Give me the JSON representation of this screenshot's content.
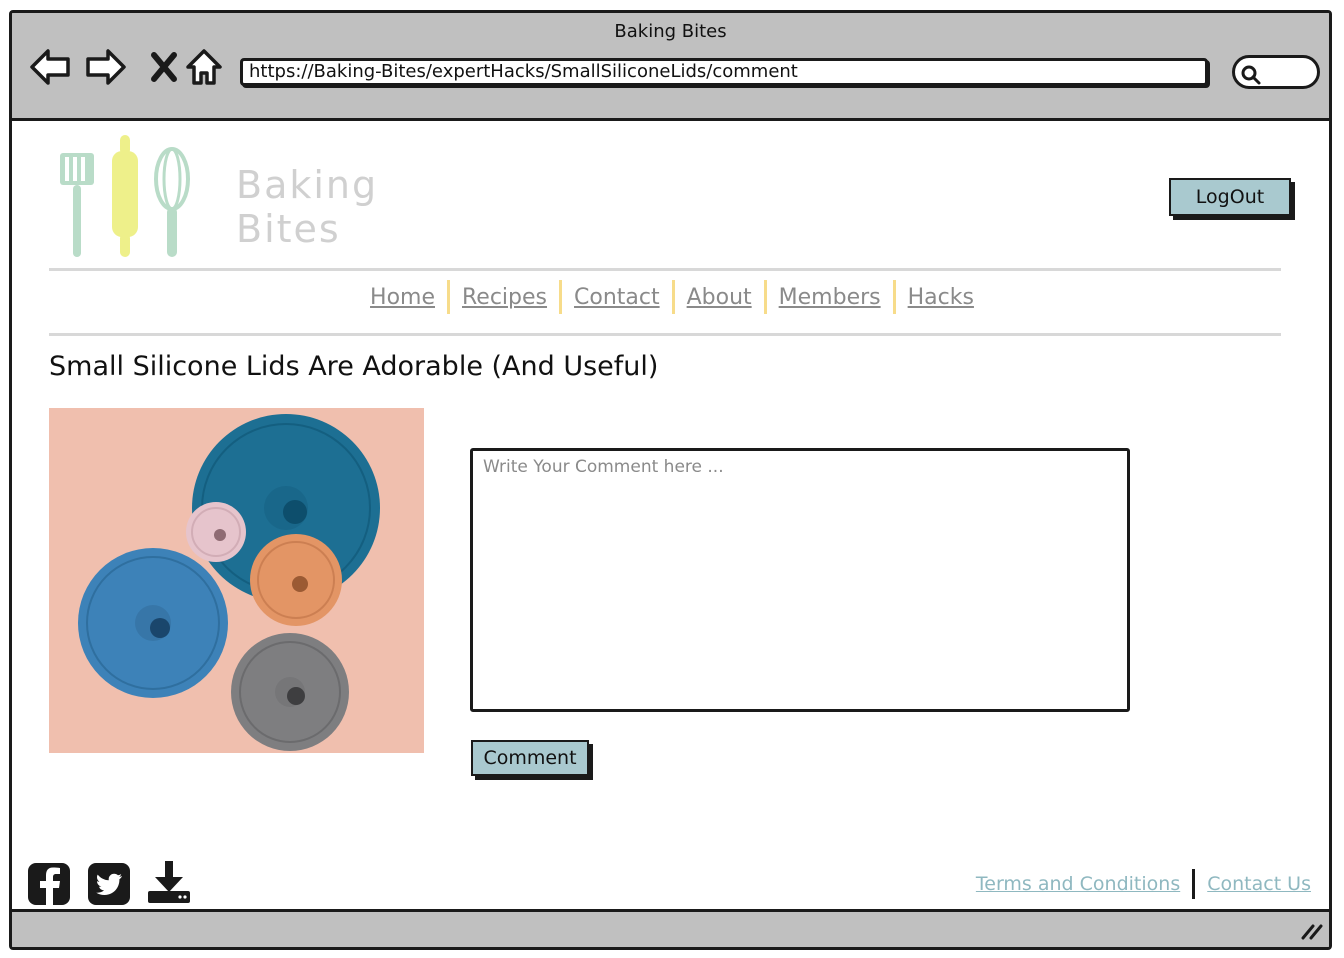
{
  "window": {
    "title": "Baking Bites"
  },
  "browser": {
    "url": "https://Baking-Bites/expertHacks/SmallSiliconeLids/comment"
  },
  "header": {
    "logo_line1": "Baking",
    "logo_line2": "Bites",
    "logout_label": "LogOut"
  },
  "nav": {
    "items": [
      {
        "label": "Home"
      },
      {
        "label": "Recipes"
      },
      {
        "label": "Contact"
      },
      {
        "label": "About"
      },
      {
        "label": "Members"
      },
      {
        "label": "Hacks"
      }
    ]
  },
  "main": {
    "title": "Small Silicone Lids Are Adorable (And Useful)",
    "comment_placeholder": "Write Your Comment here ...",
    "comment_value": "",
    "comment_button": "Comment"
  },
  "footer": {
    "icons": [
      "facebook-icon",
      "twitter-icon",
      "download-icon"
    ],
    "links": [
      {
        "label": "Terms and Conditions"
      },
      {
        "label": "Contact Us"
      }
    ]
  },
  "colors": {
    "chrome": "#c0c0c0",
    "button": "#a9c9cf",
    "nav_link": "#8a8a8a",
    "nav_separator": "#f7dc8a",
    "footer_link": "#8fb8c0"
  }
}
